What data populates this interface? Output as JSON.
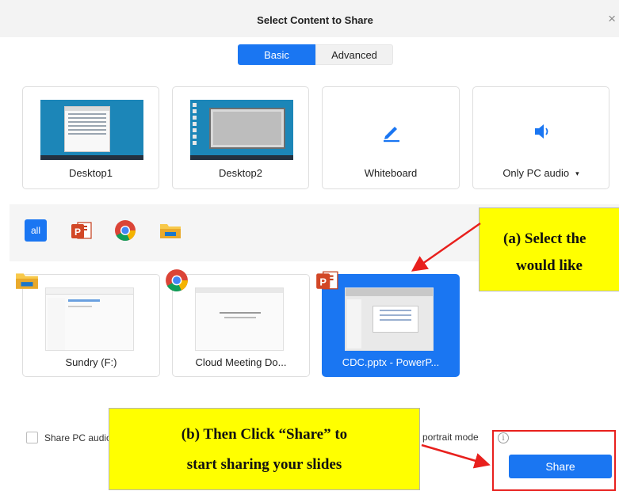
{
  "window": {
    "title": "Select Content to Share",
    "close_glyph": "×"
  },
  "tabs": [
    {
      "label": "Basic",
      "active": true
    },
    {
      "label": "Advanced",
      "active": false
    }
  ],
  "share_targets": [
    {
      "label": "Desktop1",
      "icon": "desktop-thumbnail"
    },
    {
      "label": "Desktop2",
      "icon": "desktop-thumbnail"
    },
    {
      "label": "Whiteboard",
      "icon": "pen-icon"
    },
    {
      "label": "Only PC audio",
      "icon": "speaker-icon",
      "dropdown": "▾"
    }
  ],
  "filters": [
    {
      "label": "all",
      "icon": "all-icon",
      "active": true
    },
    {
      "icon": "powerpoint-icon"
    },
    {
      "icon": "chrome-icon"
    },
    {
      "icon": "file-explorer-icon"
    }
  ],
  "apps": [
    {
      "label": "Sundry (F:)",
      "icon": "file-explorer-icon",
      "selected": false
    },
    {
      "label": "Cloud Meeting Do...",
      "icon": "chrome-icon",
      "selected": false
    },
    {
      "label": "CDC.pptx - PowerP...",
      "icon": "powerpoint-icon",
      "selected": true
    }
  ],
  "annotations": {
    "a_line1": "(a)   Select the",
    "a_line2": "would like",
    "b_line1": "(b)   Then Click “Share” to",
    "b_line2": "start sharing your slides"
  },
  "options": {
    "share_audio_label": "Share PC audio",
    "portrait_label": "portrait mode",
    "info_glyph": "i"
  },
  "share_button": {
    "label": "Share"
  },
  "colors": {
    "accent": "#1a76f2",
    "highlight": "#ffff00",
    "arrow": "#e8201d"
  }
}
